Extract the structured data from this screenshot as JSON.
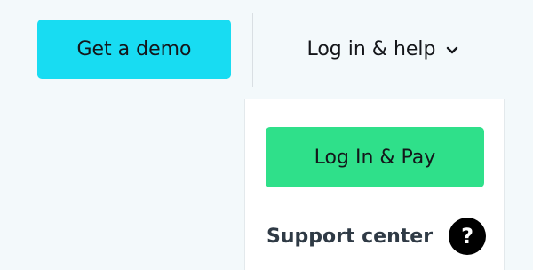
{
  "header": {
    "demo_button_label": "Get a demo",
    "login_help_label": "Log in & help",
    "login_help_icon": "chevron-down-icon"
  },
  "dropdown": {
    "pay_button_label": "Log In & Pay",
    "support_label": "Support center",
    "support_icon": "question-mark-icon",
    "support_icon_glyph": "?"
  },
  "colors": {
    "demo_button": "#18dcf2",
    "pay_button": "#2fe08a",
    "background": "#f3f9fb"
  }
}
